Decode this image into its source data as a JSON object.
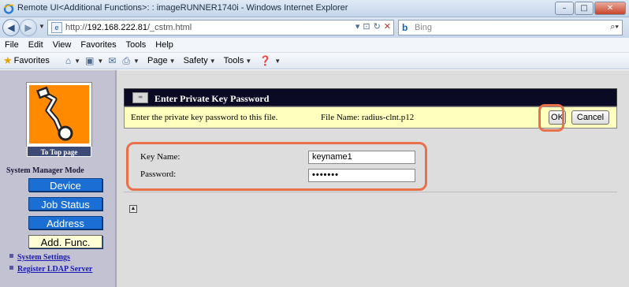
{
  "window": {
    "title": "Remote UI<Additional Functions>: : imageRUNNER1740i - Windows Internet Explorer",
    "minimize_glyph": "–",
    "maximize_glyph": "□",
    "close_glyph": "✕"
  },
  "address_bar": {
    "url_prefix": "http://",
    "url_host": "192.168.222.81",
    "url_path": "/_cstm.html"
  },
  "search_bar": {
    "placeholder": "Bing"
  },
  "menu": [
    "File",
    "Edit",
    "View",
    "Favorites",
    "Tools",
    "Help"
  ],
  "favorites_bar": {
    "favorites_label": "Favorites",
    "commands": [
      "Page",
      "Safety",
      "Tools"
    ]
  },
  "sidebar": {
    "top_page_link": "To Top page",
    "mode_label": "System Manager Mode",
    "buttons": [
      "Device",
      "Job Status",
      "Address",
      "Add. Func."
    ],
    "active_button": "Add. Func.",
    "links": [
      "System Settings",
      "Register LDAP Server"
    ]
  },
  "dialog": {
    "title": "Enter Private Key Password",
    "message": "Enter the private key password to this file.",
    "file_name_label": "File Name: radius-clnt.p12",
    "ok_label": "OK",
    "cancel_label": "Cancel",
    "key_name_label": "Key Name:",
    "key_name_value": "keyname1",
    "password_label": "Password:",
    "password_value": "•••••••"
  },
  "colors": {
    "header_bg": "#0a0a24",
    "info_bg": "#ffffbe",
    "highlight_ring": "#e8704a",
    "sidebar_button": "#1b6fd4",
    "logo_bg": "#ff8a00"
  }
}
